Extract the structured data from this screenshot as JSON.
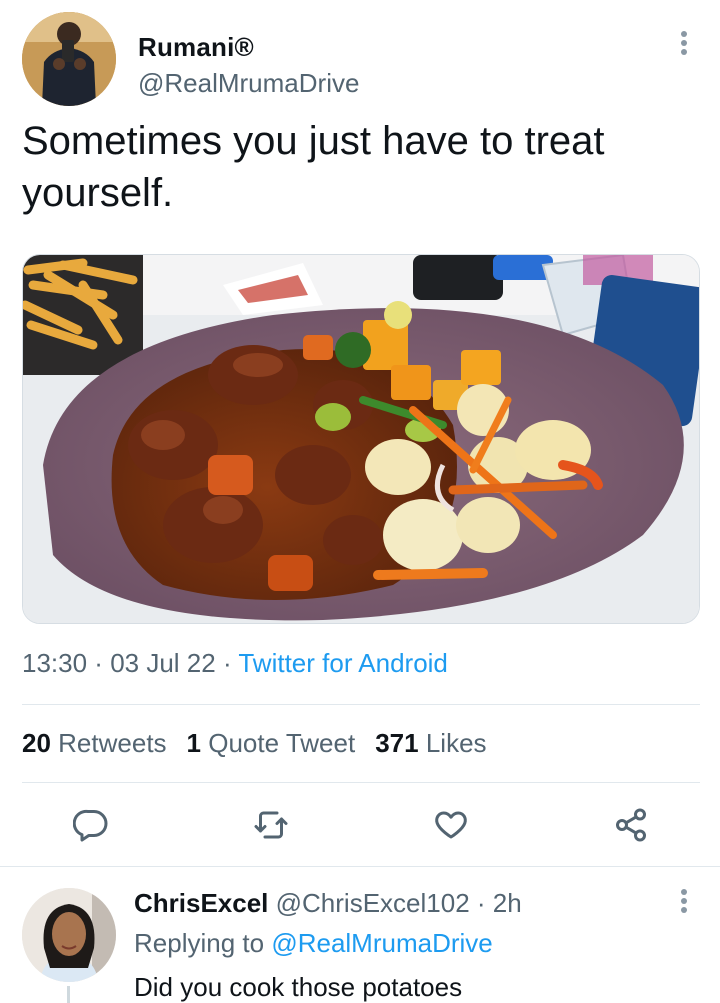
{
  "tweet": {
    "author_name": "Rumani®",
    "author_handle": "@RealMrumaDrive",
    "text": "Sometimes you just have to treat yourself.",
    "time": "13:30",
    "sep1": " · ",
    "date": "03 Jul 22",
    "sep2": " · ",
    "source": "Twitter for Android",
    "media_icon": "food-photo",
    "more_icon": "more-vertical-icon"
  },
  "stats": {
    "retweets_count": "20",
    "retweets_label": "Retweets",
    "quotes_count": "1",
    "quotes_label": "Quote Tweet",
    "likes_count": "371",
    "likes_label": "Likes"
  },
  "actions": {
    "reply_icon": "comment-icon",
    "retweet_icon": "retweet-icon",
    "like_icon": "heart-icon",
    "share_icon": "share-icon"
  },
  "reply": {
    "name": "ChrisExcel",
    "handle": "@ChrisExcel102",
    "sep": " · ",
    "time": "2h",
    "replying_prefix": "Replying to ",
    "replying_to": "@RealMrumaDrive",
    "text": "Did you cook those potatoes"
  },
  "colors": {
    "accent": "#1d9bf0",
    "secondary_text": "#536471",
    "primary_text": "#0f1419",
    "divider": "#e1e8ed"
  }
}
